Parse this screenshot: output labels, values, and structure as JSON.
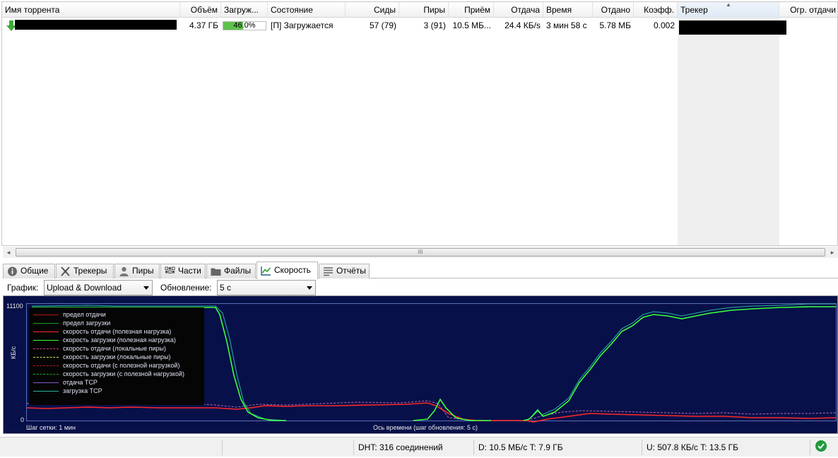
{
  "columns": {
    "name": "Имя торрента",
    "size": "Объём",
    "done": "Загруж...",
    "status": "Состояние",
    "seeds": "Сиды",
    "peers": "Пиры",
    "down_speed": "Приём",
    "up_speed": "Отдача",
    "eta": "Время",
    "uploaded": "Отдано",
    "ratio": "Коэфф.",
    "tracker": "Трекер",
    "up_limit": "Огр. отдачи"
  },
  "torrent": {
    "size": "4.37 ГБ",
    "progress_text": "46.0%",
    "progress": 0.46,
    "status": "[П] Загружается",
    "seeds": "57 (79)",
    "peers": "3 (91)",
    "down_speed": "10.5 МБ...",
    "up_speed": "24.4 КБ/s",
    "eta": "3 мин 58 с",
    "uploaded": "5.78 МБ",
    "ratio": "0.002"
  },
  "scrollbar": {
    "grip": "III"
  },
  "tabs": [
    "Общие",
    "Трекеры",
    "Пиры",
    "Части",
    "Файлы",
    "Скорость",
    "Отчёты"
  ],
  "active_tab": "Скорость",
  "graph_controls": {
    "graph_label": "График:",
    "graph_value": "Upload & Download",
    "refresh_label": "Обновление:",
    "refresh_value": "5 с"
  },
  "graph": {
    "y_max": "11100",
    "y_min": "0",
    "y_unit": "КБ/с",
    "grid_step": "Шаг сетки: 1 мин",
    "x_axis": "Ось времени (шаг обновления: 5 с)",
    "legend": [
      {
        "label": "предел отдачи",
        "color": "#b01818",
        "style": "solid"
      },
      {
        "label": "предел загрузки",
        "color": "#1a9a1a",
        "style": "solid"
      },
      {
        "label": "скорость отдачи (полезная нагрузка)",
        "color": "#ff2a2a",
        "style": "solid"
      },
      {
        "label": "скорость загрузки (полезная нагрузка)",
        "color": "#3aff3a",
        "style": "solid"
      },
      {
        "label": "скорость отдачи (локальные пиры)",
        "color": "#d43a8a",
        "style": "dashed"
      },
      {
        "label": "скорость загрузки (локальные пиры)",
        "color": "#c8f060",
        "style": "dashed"
      },
      {
        "label": "скорость отдачи (с полезной нагрузкой)",
        "color": "#c01818",
        "style": "dashed"
      },
      {
        "label": "скорость загрузки (с полезной нагрузкой)",
        "color": "#18a818",
        "style": "dashed"
      },
      {
        "label": "отдача TCP",
        "color": "#8a58c8",
        "style": "solid"
      },
      {
        "label": "загрузка TCP",
        "color": "#2ab0a0",
        "style": "solid"
      }
    ]
  },
  "statusbar": {
    "dht": "DHT: 316 соединений",
    "download": "D: 10.5 МБ/с T: 7.9 ГБ",
    "upload": "U: 507.8 КБ/с T: 13.5 ГБ"
  }
}
